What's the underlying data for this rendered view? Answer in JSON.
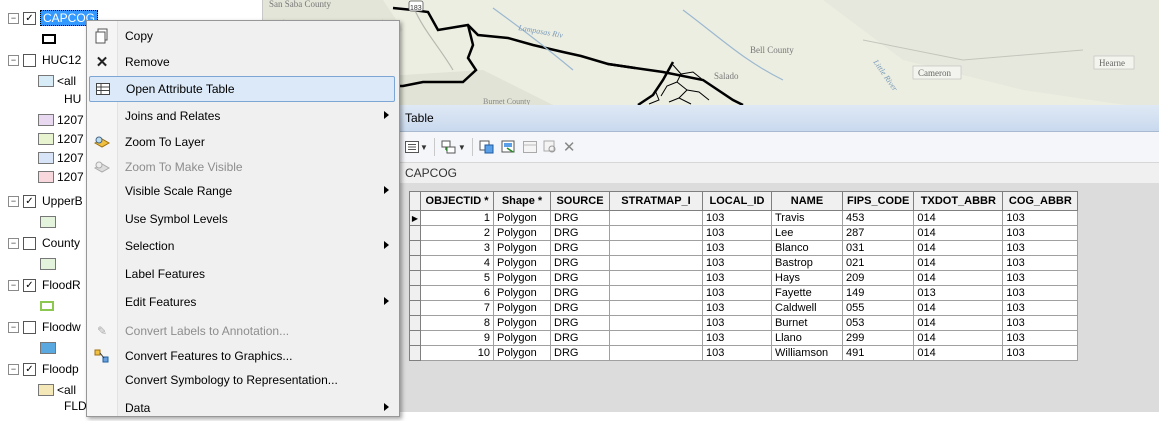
{
  "toc": {
    "rows": [
      {
        "expander": "⊟",
        "checked": true,
        "label": "CAPCOG",
        "selected": true
      },
      {
        "label": ""
      },
      {
        "expander": "⊟",
        "checked": false,
        "label": "HUC12"
      },
      {
        "label": "<all"
      },
      {
        "label": "HU"
      },
      {
        "label": "1207"
      },
      {
        "label": "1207"
      },
      {
        "label": "1207"
      },
      {
        "label": "1207"
      },
      {
        "expander": "⊟",
        "checked": true,
        "label": "UpperB"
      },
      {
        "expander": "⊟",
        "checked": false,
        "label": "County"
      },
      {
        "expander": "⊟",
        "checked": true,
        "label": "FloodR"
      },
      {
        "expander": "⊟",
        "checked": false,
        "label": "Floodw"
      },
      {
        "expander": "⊟",
        "checked": true,
        "label": "Floodp"
      },
      {
        "label": "<all"
      },
      {
        "label": "FLD"
      }
    ],
    "swatch_colors": {
      "huc_all": "#d8ecf8",
      "huc_a": "#e8d8f0",
      "huc_b": "#e8f4d0",
      "huc_c": "#d8e4f8",
      "huc_d": "#f8d8dc",
      "upperb": "#e4f4dc",
      "county": "#e4f4dc",
      "floodr": "#b8e090",
      "floodw": "#5aa8e0",
      "floodp": "#f4e8b8"
    }
  },
  "map": {
    "labels": {
      "san_saba": "San Saba County",
      "hwy": "183",
      "bell": "Bell County",
      "salado": "Salado",
      "cameron": "Cameron",
      "hearne": "Hearne",
      "burnet": "Burnet County",
      "little_river": "Little River",
      "lampasas": "Lampasas Riv"
    }
  },
  "context_menu": {
    "items": [
      {
        "label": "Copy",
        "icon": "copy-icon",
        "enabled": true,
        "submenu": false
      },
      {
        "label": "Remove",
        "icon": "remove-icon",
        "enabled": true,
        "submenu": false
      },
      {
        "label": "Open Attribute Table",
        "icon": "table-icon",
        "enabled": true,
        "submenu": false,
        "highlighted": true
      },
      {
        "label": "Joins and Relates",
        "icon": "",
        "enabled": true,
        "submenu": true
      },
      {
        "label": "Zoom To Layer",
        "icon": "zoom-layer-icon",
        "enabled": true,
        "submenu": false
      },
      {
        "label": "Zoom To Make Visible",
        "icon": "zoom-visible-icon",
        "enabled": false,
        "submenu": false
      },
      {
        "label": "Visible Scale Range",
        "icon": "",
        "enabled": true,
        "submenu": true
      },
      {
        "label": "Use Symbol Levels",
        "icon": "",
        "enabled": true,
        "submenu": false
      },
      {
        "label": "Selection",
        "icon": "",
        "enabled": true,
        "submenu": true
      },
      {
        "label": "Label Features",
        "icon": "",
        "enabled": true,
        "submenu": false
      },
      {
        "label": "Edit Features",
        "icon": "",
        "enabled": true,
        "submenu": true
      },
      {
        "label": "Convert Labels to Annotation...",
        "icon": "convert-labels-icon",
        "enabled": false,
        "submenu": false
      },
      {
        "label": "Convert Features to Graphics...",
        "icon": "convert-graphics-icon",
        "enabled": true,
        "submenu": false
      },
      {
        "label": "Convert Symbology to Representation...",
        "icon": "",
        "enabled": true,
        "submenu": false
      },
      {
        "label": "Data",
        "icon": "",
        "enabled": true,
        "submenu": true
      }
    ]
  },
  "table_window": {
    "title": "Table",
    "table_name": "CAPCOG",
    "columns": [
      "OBJECTID *",
      "Shape *",
      "SOURCE",
      "STRATMAP_I",
      "LOCAL_ID",
      "NAME",
      "FIPS_CODE",
      "TXDOT_ABBR",
      "COG_ABBR"
    ],
    "rows": [
      [
        "1",
        "Polygon",
        "DRG",
        "",
        "103",
        "Travis",
        "453",
        "014",
        "103"
      ],
      [
        "2",
        "Polygon",
        "DRG",
        "",
        "103",
        "Lee",
        "287",
        "014",
        "103"
      ],
      [
        "3",
        "Polygon",
        "DRG",
        "",
        "103",
        "Blanco",
        "031",
        "014",
        "103"
      ],
      [
        "4",
        "Polygon",
        "DRG",
        "",
        "103",
        "Bastrop",
        "021",
        "014",
        "103"
      ],
      [
        "5",
        "Polygon",
        "DRG",
        "",
        "103",
        "Hays",
        "209",
        "014",
        "103"
      ],
      [
        "6",
        "Polygon",
        "DRG",
        "",
        "103",
        "Fayette",
        "149",
        "013",
        "103"
      ],
      [
        "7",
        "Polygon",
        "DRG",
        "",
        "103",
        "Caldwell",
        "055",
        "014",
        "103"
      ],
      [
        "8",
        "Polygon",
        "DRG",
        "",
        "103",
        "Burnet",
        "053",
        "014",
        "103"
      ],
      [
        "9",
        "Polygon",
        "DRG",
        "",
        "103",
        "Llano",
        "299",
        "014",
        "103"
      ],
      [
        "10",
        "Polygon",
        "DRG",
        "",
        "103",
        "Williamson",
        "491",
        "014",
        "103"
      ]
    ]
  }
}
